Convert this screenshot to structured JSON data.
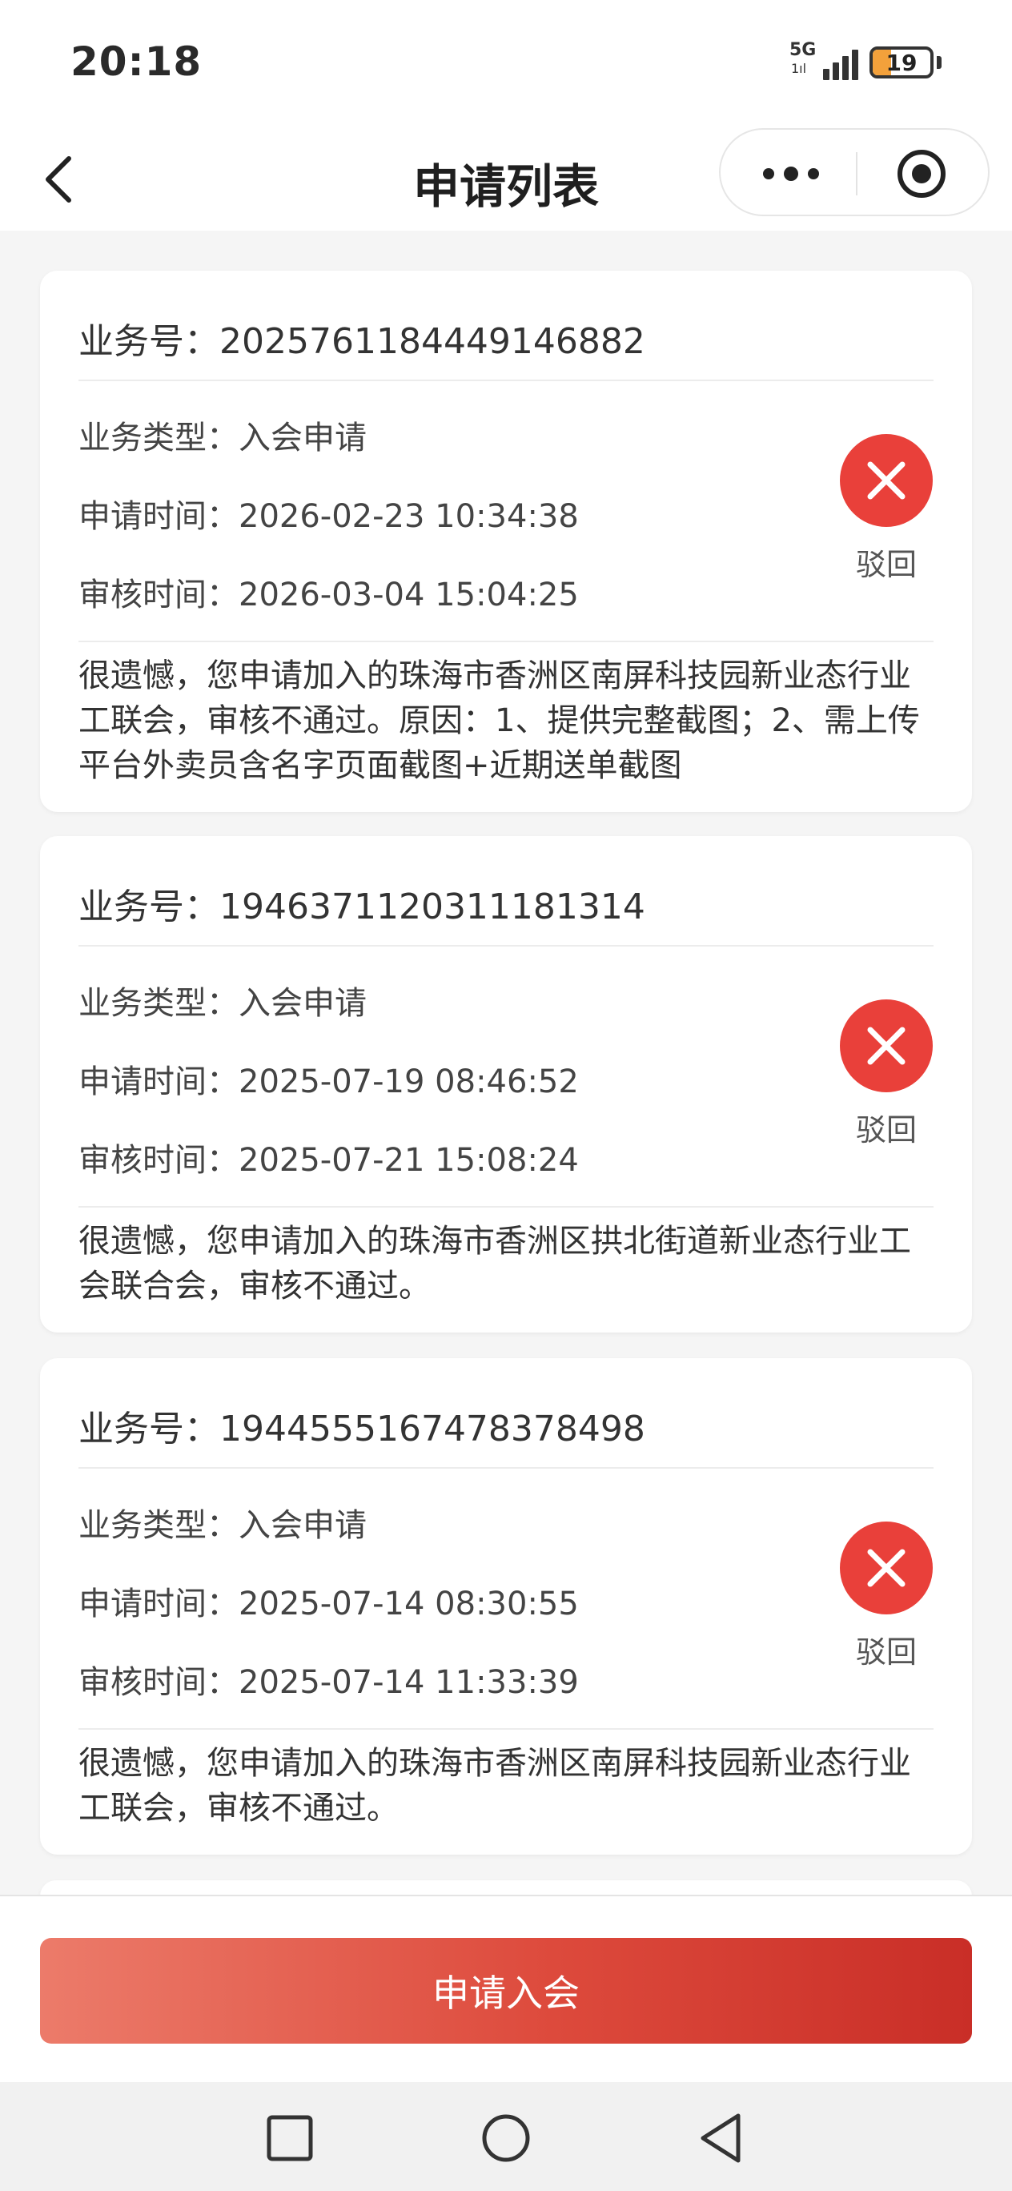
{
  "status_bar": {
    "time": "20:18",
    "network": "5G",
    "network_sub": "1ıl",
    "battery": "19",
    "colors": {
      "battery_fill": "#f3a13b"
    }
  },
  "nav": {
    "title": "申请列表",
    "icons": {
      "back": "chevron-left-icon",
      "more": "more-dots-icon",
      "target": "target-icon"
    }
  },
  "records": [
    {
      "biz_no": "业务号：2025761184449146882",
      "type": "业务类型：入会申请",
      "apply_time": "申请时间：2026-02-23 10:34:38",
      "review_time": "审核时间：2026-03-04 15:04:25",
      "status": "驳回",
      "message": "很遗憾，您申请加入的珠海市香洲区南屏科技园新业态行业工联会，审核不通过。原因：1、提供完整截图；2、需上传平台外卖员含名字页面截图+近期送单截图"
    },
    {
      "biz_no": "业务号：1946371120311181314",
      "type": "业务类型：入会申请",
      "apply_time": "申请时间：2025-07-19 08:46:52",
      "review_time": "审核时间：2025-07-21 15:08:24",
      "status": "驳回",
      "message": "很遗憾，您申请加入的珠海市香洲区拱北街道新业态行业工会联合会，审核不通过。"
    },
    {
      "biz_no": "业务号：1944555167478378498",
      "type": "业务类型：入会申请",
      "apply_time": "申请时间：2025-07-14 08:30:55",
      "review_time": "审核时间：2025-07-14 11:33:39",
      "status": "驳回",
      "message": "很遗憾，您申请加入的珠海市香洲区南屏科技园新业态行业工联会，审核不通过。"
    }
  ],
  "actions": {
    "apply_label": "申请入会"
  },
  "colors": {
    "reject": "#e9403a",
    "button_start": "#ec7b6a",
    "button_end": "#c92e27",
    "page_bg": "#f5f5f5"
  },
  "system_nav": {
    "icons": [
      "square-icon",
      "circle-icon",
      "triangle-back-icon"
    ]
  }
}
